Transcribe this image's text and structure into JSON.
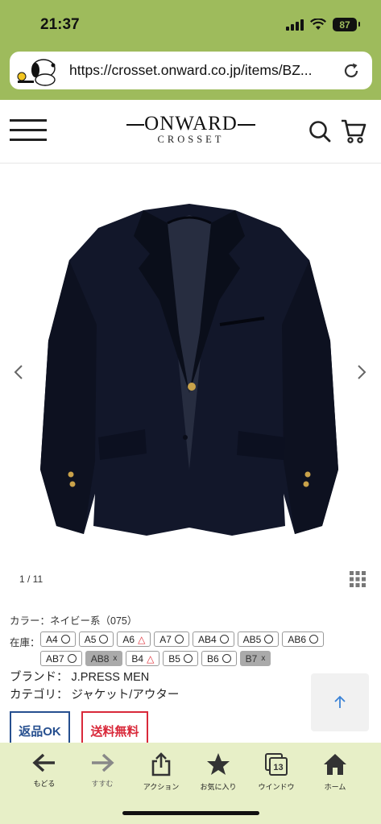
{
  "status": {
    "time": "21:37",
    "battery": "87"
  },
  "browser": {
    "url": "https://crosset.onward.co.jp/items/BZ..."
  },
  "site": {
    "logo_main": "ONWARD",
    "logo_sub": "CROSSET"
  },
  "gallery": {
    "counter": "1 / 11"
  },
  "product": {
    "color": "カラー：ネイビー系（075）",
    "stock_label": "在庫：",
    "sizes_row1": [
      {
        "size": "A4",
        "mark": "ok"
      },
      {
        "size": "A5",
        "mark": "ok"
      },
      {
        "size": "A6",
        "mark": "few"
      },
      {
        "size": "A7",
        "mark": "ok"
      },
      {
        "size": "AB4",
        "mark": "ok"
      },
      {
        "size": "AB5",
        "mark": "ok"
      },
      {
        "size": "AB6",
        "mark": "ok"
      }
    ],
    "sizes_row2": [
      {
        "size": "AB7",
        "mark": "ok"
      },
      {
        "size": "AB8",
        "mark": "x"
      },
      {
        "size": "B4",
        "mark": "few"
      },
      {
        "size": "B5",
        "mark": "ok"
      },
      {
        "size": "B6",
        "mark": "ok"
      },
      {
        "size": "B7",
        "mark": "x"
      }
    ],
    "brand": "ブランド： J.PRESS MEN",
    "category": "カテゴリ： ジャケット/アウター",
    "badge_return": "返品OK",
    "badge_shipping": "送料無料"
  },
  "toolbar": {
    "back": "もどる",
    "forward": "すすむ",
    "share": "アクション",
    "bookmark": "お気に入り",
    "tabs": "ウインドウ",
    "tabs_count": "13",
    "home": "ホーム"
  },
  "colors": {
    "chrome": "#9ebb5c",
    "toolbar": "#e7efc7",
    "navy": "#264f8f",
    "red": "#d9293a"
  }
}
